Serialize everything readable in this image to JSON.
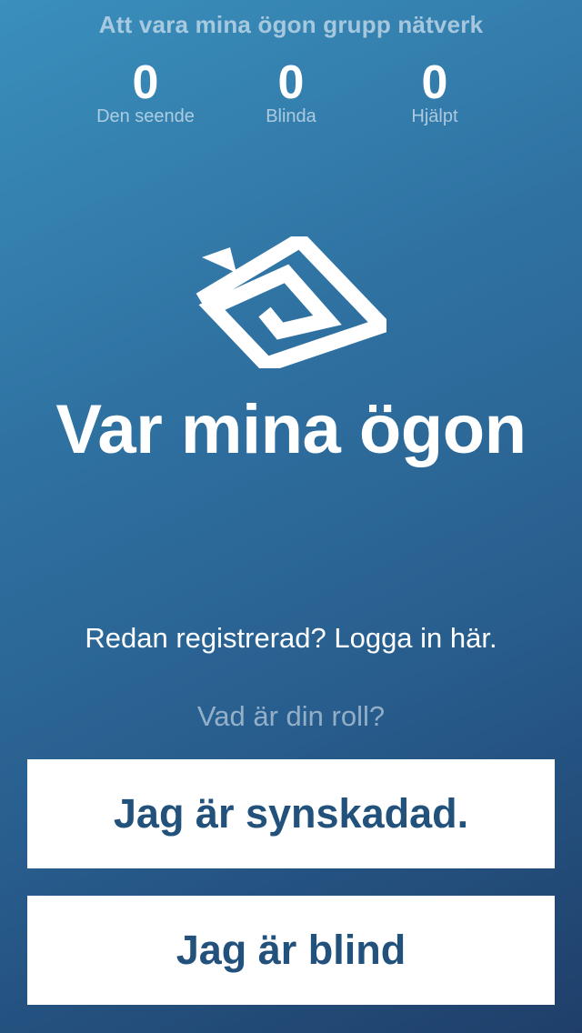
{
  "header": {
    "network_title": "Att vara mina ögon grupp nätverk",
    "stats": [
      {
        "value": "0",
        "label": "Den seende"
      },
      {
        "value": "0",
        "label": "Blinda"
      },
      {
        "value": "0",
        "label": "Hjälpt"
      }
    ]
  },
  "logo": {
    "icon": "spiral-eye-logo-icon"
  },
  "app_title": "Var mina ögon",
  "login_link": "Redan registrerad? Logga in här.",
  "role_prompt": "Vad är din roll?",
  "buttons": {
    "visually_impaired": "Jag är synskadad.",
    "blind": "Jag är blind"
  },
  "colors": {
    "gradient_start": "#3a8fbc",
    "gradient_end": "#1f3f6a",
    "button_text": "#22517c",
    "button_background": "#ffffff"
  }
}
